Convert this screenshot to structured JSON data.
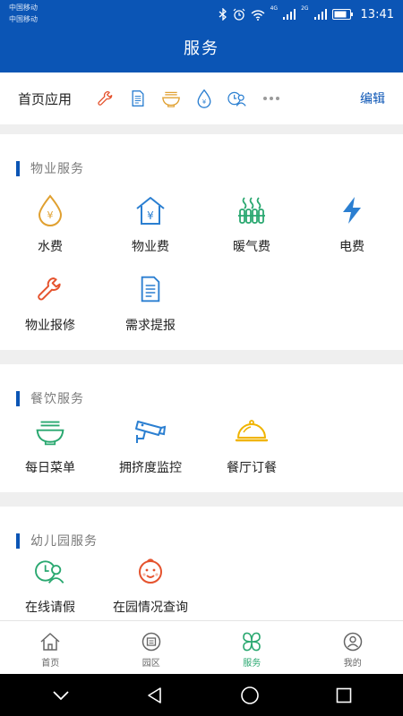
{
  "status_bar": {
    "carrier_1": "中国移动",
    "carrier_2": "中国移动",
    "network_1": "4G",
    "network_2": "2G",
    "time": "13:41"
  },
  "header": {
    "title": "服务"
  },
  "home_apps": {
    "label": "首页应用",
    "edit_label": "编辑",
    "icons": [
      "wrench-icon",
      "document-icon",
      "noodle-bowl-icon",
      "water-drop-icon",
      "user-clock-icon",
      "more-icon"
    ]
  },
  "sections": {
    "property": {
      "title": "物业服务",
      "items": [
        {
          "label": "水费",
          "icon": "water-drop-icon"
        },
        {
          "label": "物业费",
          "icon": "house-yen-icon"
        },
        {
          "label": "暖气费",
          "icon": "radiator-icon"
        },
        {
          "label": "电费",
          "icon": "lightning-icon"
        },
        {
          "label": "物业报修",
          "icon": "wrench-icon"
        },
        {
          "label": "需求提报",
          "icon": "document-icon"
        }
      ]
    },
    "dining": {
      "title": "餐饮服务",
      "items": [
        {
          "label": "每日菜单",
          "icon": "noodle-bowl-icon"
        },
        {
          "label": "拥挤度监控",
          "icon": "camera-icon"
        },
        {
          "label": "餐厅订餐",
          "icon": "food-cloche-icon"
        }
      ]
    },
    "kindergarten": {
      "title": "幼儿园服务",
      "items": [
        {
          "label": "在线请假",
          "icon": "user-clock-icon"
        },
        {
          "label": "在园情况查询",
          "icon": "baby-face-icon"
        }
      ]
    }
  },
  "bottom_nav": {
    "items": [
      {
        "label": "首页",
        "icon": "home-icon"
      },
      {
        "label": "园区",
        "icon": "park-icon"
      },
      {
        "label": "服务",
        "icon": "clover-icon",
        "active": true
      },
      {
        "label": "我的",
        "icon": "user-icon"
      }
    ]
  },
  "colors": {
    "brand_blue": "#0b55b5",
    "active_green": "#2aa870",
    "icon_orange": "#e0a030",
    "icon_red": "#e5532e",
    "icon_teal": "#2aa870",
    "icon_blue": "#2b7fd1",
    "icon_yellow": "#f0b400"
  }
}
